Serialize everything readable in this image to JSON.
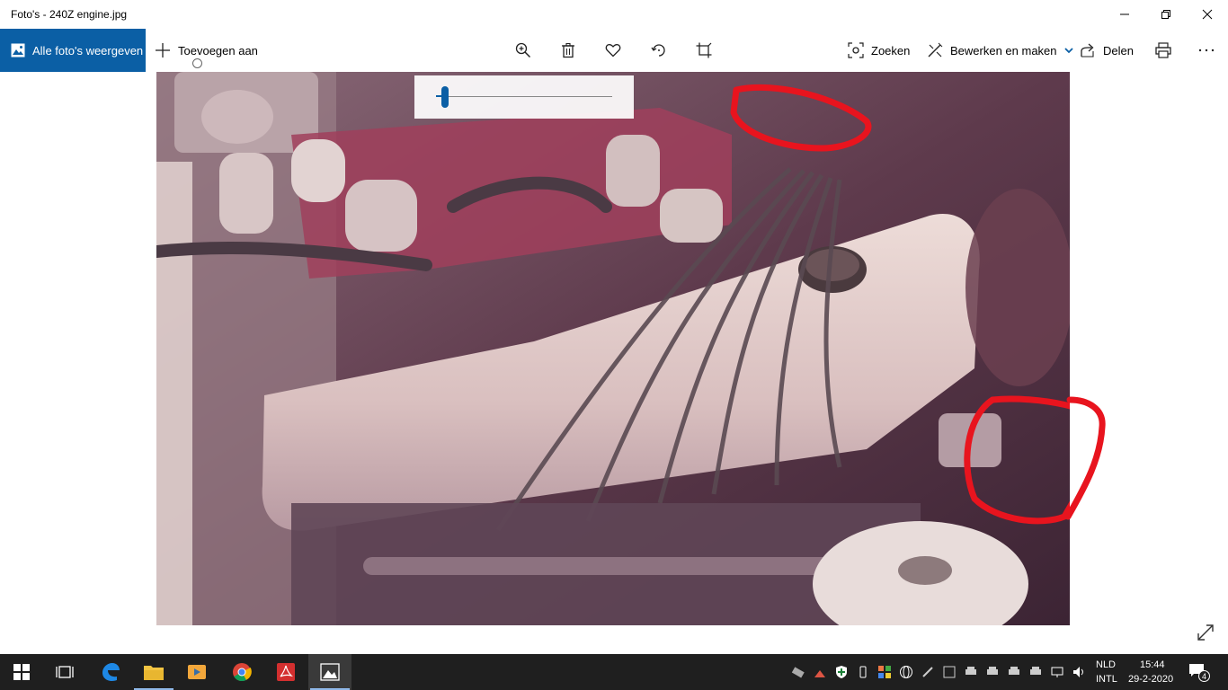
{
  "window": {
    "title": "Foto's - 240Z engine.jpg"
  },
  "commandbar": {
    "all_photos": "Alle foto's weergeven",
    "add_to": "Toevoegen aan",
    "search": "Zoeken",
    "edit_create": "Bewerken en maken",
    "share": "Delen"
  },
  "zoom": {
    "level": 0.05
  },
  "taskbar": {
    "language_top": "NLD",
    "language_bottom": "INTL",
    "time": "15:44",
    "date": "29-2-2020",
    "notification_count": "4"
  },
  "colors": {
    "accent": "#0b5fa5",
    "annotation": "#e8141e",
    "taskbar": "#1f1f1f"
  }
}
